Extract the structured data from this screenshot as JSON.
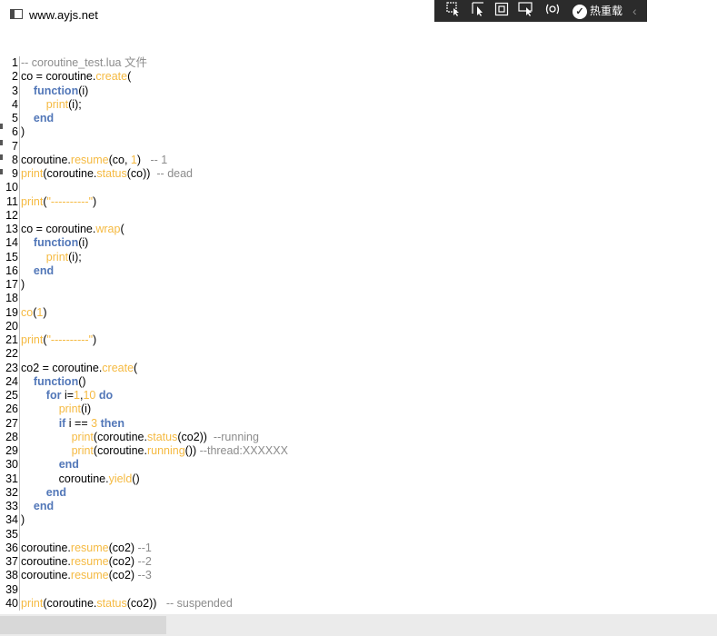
{
  "window": {
    "title": "www.ayjs.net"
  },
  "devbar": {
    "hot_reload_label": "热重载"
  },
  "code_lines": [
    {
      "n": "1",
      "t": [
        [
          "cm",
          "-- coroutine_test.lua 文件"
        ]
      ]
    },
    {
      "n": "2",
      "t": [
        [
          "p",
          "co = coroutine."
        ],
        [
          "fn",
          "create"
        ],
        [
          "p",
          "("
        ]
      ]
    },
    {
      "n": "3",
      "t": [
        [
          "p",
          "    "
        ],
        [
          "kw",
          "function"
        ],
        [
          "p",
          "(i)"
        ]
      ]
    },
    {
      "n": "4",
      "t": [
        [
          "p",
          "        "
        ],
        [
          "fn",
          "print"
        ],
        [
          "p",
          "(i);"
        ]
      ]
    },
    {
      "n": "5",
      "t": [
        [
          "p",
          "    "
        ],
        [
          "kw",
          "end"
        ]
      ]
    },
    {
      "n": "6",
      "t": [
        [
          "p",
          ")"
        ]
      ]
    },
    {
      "n": "7",
      "t": []
    },
    {
      "n": "8",
      "t": [
        [
          "p",
          "coroutine."
        ],
        [
          "fn",
          "resume"
        ],
        [
          "p",
          "(co, "
        ],
        [
          "num",
          "1"
        ],
        [
          "p",
          ")   "
        ],
        [
          "cm",
          "-- 1"
        ]
      ]
    },
    {
      "n": "9",
      "t": [
        [
          "fn",
          "print"
        ],
        [
          "p",
          "(coroutine."
        ],
        [
          "fn",
          "status"
        ],
        [
          "p",
          "(co))  "
        ],
        [
          "cm",
          "-- dead"
        ]
      ]
    },
    {
      "n": "10",
      "t": []
    },
    {
      "n": "11",
      "t": [
        [
          "fn",
          "print"
        ],
        [
          "p",
          "("
        ],
        [
          "str",
          "\"----------\""
        ],
        [
          "p",
          ")"
        ]
      ]
    },
    {
      "n": "12",
      "t": []
    },
    {
      "n": "13",
      "t": [
        [
          "p",
          "co = coroutine."
        ],
        [
          "fn",
          "wrap"
        ],
        [
          "p",
          "("
        ]
      ]
    },
    {
      "n": "14",
      "t": [
        [
          "p",
          "    "
        ],
        [
          "kw",
          "function"
        ],
        [
          "p",
          "(i)"
        ]
      ]
    },
    {
      "n": "15",
      "t": [
        [
          "p",
          "        "
        ],
        [
          "fn",
          "print"
        ],
        [
          "p",
          "(i);"
        ]
      ]
    },
    {
      "n": "16",
      "t": [
        [
          "p",
          "    "
        ],
        [
          "kw",
          "end"
        ]
      ]
    },
    {
      "n": "17",
      "t": [
        [
          "p",
          ")"
        ]
      ]
    },
    {
      "n": "18",
      "t": []
    },
    {
      "n": "19",
      "t": [
        [
          "fn",
          "co"
        ],
        [
          "p",
          "("
        ],
        [
          "num",
          "1"
        ],
        [
          "p",
          ")"
        ]
      ]
    },
    {
      "n": "20",
      "t": []
    },
    {
      "n": "21",
      "t": [
        [
          "fn",
          "print"
        ],
        [
          "p",
          "("
        ],
        [
          "str",
          "\"----------\""
        ],
        [
          "p",
          ")"
        ]
      ]
    },
    {
      "n": "22",
      "t": []
    },
    {
      "n": "23",
      "t": [
        [
          "p",
          "co2 = coroutine."
        ],
        [
          "fn",
          "create"
        ],
        [
          "p",
          "("
        ]
      ]
    },
    {
      "n": "24",
      "t": [
        [
          "p",
          "    "
        ],
        [
          "kw",
          "function"
        ],
        [
          "p",
          "()"
        ]
      ]
    },
    {
      "n": "25",
      "t": [
        [
          "p",
          "        "
        ],
        [
          "kw",
          "for"
        ],
        [
          "p",
          " i="
        ],
        [
          "num",
          "1"
        ],
        [
          "p",
          ","
        ],
        [
          "num",
          "10"
        ],
        [
          "p",
          " "
        ],
        [
          "kw",
          "do"
        ]
      ]
    },
    {
      "n": "26",
      "t": [
        [
          "p",
          "            "
        ],
        [
          "fn",
          "print"
        ],
        [
          "p",
          "(i)"
        ]
      ]
    },
    {
      "n": "27",
      "t": [
        [
          "p",
          "            "
        ],
        [
          "kw",
          "if"
        ],
        [
          "p",
          " i == "
        ],
        [
          "num",
          "3"
        ],
        [
          "p",
          " "
        ],
        [
          "kw",
          "then"
        ]
      ]
    },
    {
      "n": "28",
      "t": [
        [
          "p",
          "                "
        ],
        [
          "fn",
          "print"
        ],
        [
          "p",
          "(coroutine."
        ],
        [
          "fn",
          "status"
        ],
        [
          "p",
          "(co2))  "
        ],
        [
          "cm",
          "--running"
        ]
      ]
    },
    {
      "n": "29",
      "t": [
        [
          "p",
          "                "
        ],
        [
          "fn",
          "print"
        ],
        [
          "p",
          "(coroutine."
        ],
        [
          "fn",
          "running"
        ],
        [
          "p",
          "()) "
        ],
        [
          "cm",
          "--thread:XXXXXX"
        ]
      ]
    },
    {
      "n": "30",
      "t": [
        [
          "p",
          "            "
        ],
        [
          "kw",
          "end"
        ]
      ]
    },
    {
      "n": "31",
      "t": [
        [
          "p",
          "            coroutine."
        ],
        [
          "fn",
          "yield"
        ],
        [
          "p",
          "()"
        ]
      ]
    },
    {
      "n": "32",
      "t": [
        [
          "p",
          "        "
        ],
        [
          "kw",
          "end"
        ]
      ]
    },
    {
      "n": "33",
      "t": [
        [
          "p",
          "    "
        ],
        [
          "kw",
          "end"
        ]
      ]
    },
    {
      "n": "34",
      "t": [
        [
          "p",
          ")"
        ]
      ]
    },
    {
      "n": "35",
      "t": []
    },
    {
      "n": "36",
      "t": [
        [
          "p",
          "coroutine."
        ],
        [
          "fn",
          "resume"
        ],
        [
          "p",
          "(co2) "
        ],
        [
          "cm",
          "--1"
        ]
      ]
    },
    {
      "n": "37",
      "t": [
        [
          "p",
          "coroutine."
        ],
        [
          "fn",
          "resume"
        ],
        [
          "p",
          "(co2) "
        ],
        [
          "cm",
          "--2"
        ]
      ]
    },
    {
      "n": "38",
      "t": [
        [
          "p",
          "coroutine."
        ],
        [
          "fn",
          "resume"
        ],
        [
          "p",
          "(co2) "
        ],
        [
          "cm",
          "--3"
        ]
      ]
    },
    {
      "n": "39",
      "t": []
    },
    {
      "n": "40",
      "t": [
        [
          "fn",
          "print"
        ],
        [
          "p",
          "(coroutine."
        ],
        [
          "fn",
          "status"
        ],
        [
          "p",
          "(co2))   "
        ],
        [
          "cm",
          "-- suspended"
        ]
      ]
    }
  ],
  "colors": {
    "keyword": "#5277b8",
    "function": "#f5ba42",
    "comment": "#8c8c8c",
    "devbar": "#2b2b2b"
  },
  "icons": [
    "window-app-icon",
    "select-element-icon",
    "pointer-icon",
    "layout-adorner-icon",
    "track-focus-icon",
    "hot-reload-status-icon",
    "check-icon",
    "chevron-left-icon"
  ]
}
